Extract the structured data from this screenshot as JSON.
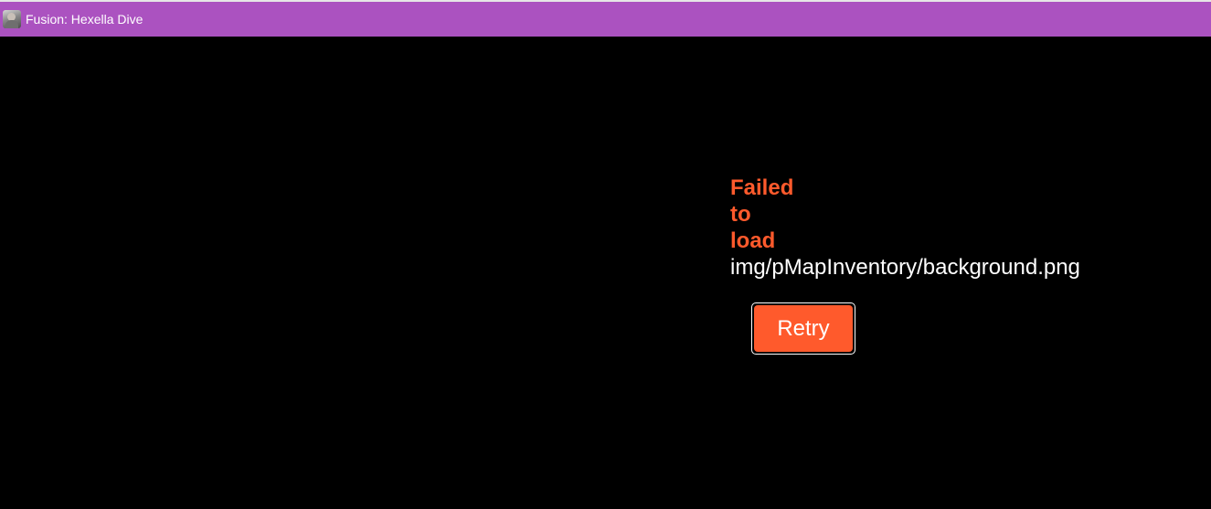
{
  "window": {
    "title": "Fusion: Hexella Dive",
    "icon": "app-avatar-icon",
    "titlebar_color": "#ab52c0"
  },
  "error": {
    "words": [
      "Failed",
      "to",
      "load"
    ],
    "path": "img/pMapInventory/background.png",
    "color": "#ff5a2c"
  },
  "retry": {
    "label": "Retry",
    "color": "#ff5a2c"
  }
}
